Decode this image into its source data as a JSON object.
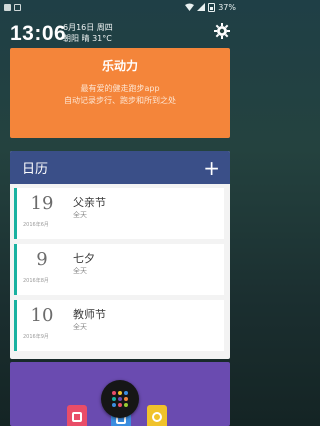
{
  "status_bar": {
    "battery": "37%"
  },
  "clock_widget": {
    "time": "13:06",
    "date_line": "6月16日 周四",
    "weather_line": "朝阳 晴 31°C"
  },
  "motion_card": {
    "title": "乐动力",
    "line1": "最有爱的健走跑步app",
    "line2": "自动记录步行、跑步和所到之处"
  },
  "calendar_card": {
    "title": "日历",
    "add_label": "+",
    "events": [
      {
        "day": "19",
        "month": "2016年6月",
        "name": "父亲节",
        "sub": "全天"
      },
      {
        "day": "9",
        "month": "2016年8月",
        "name": "七夕",
        "sub": "全天"
      },
      {
        "day": "10",
        "month": "2016年9月",
        "name": "教师节",
        "sub": "全天"
      }
    ]
  },
  "colors": {
    "motion_bg": "#f4853a",
    "calendar_header": "#3a4f88",
    "event_accent": "#19b1a0",
    "bottom_card": "#6a4bb0"
  },
  "icons": [
    "signal-icon",
    "settings-gear-icon",
    "add-icon",
    "launcher-grid-icon"
  ]
}
